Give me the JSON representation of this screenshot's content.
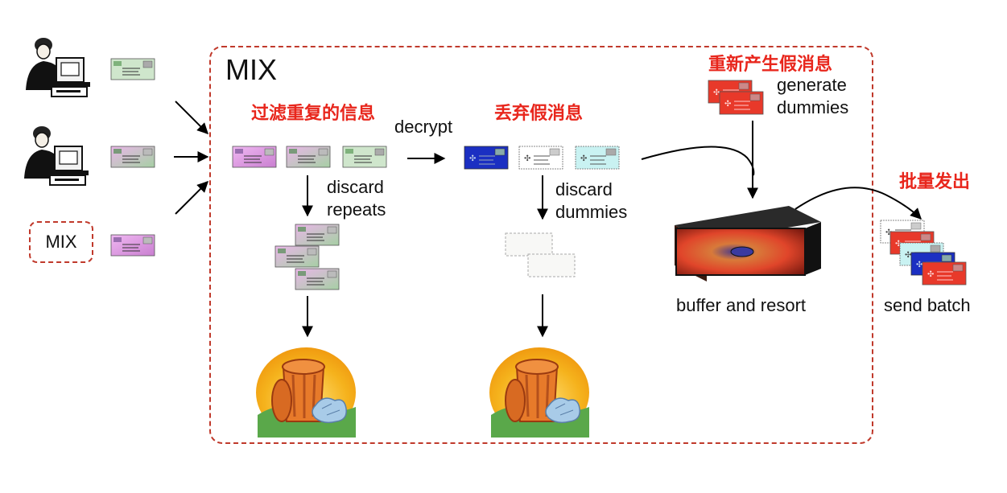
{
  "mix_box": {
    "title": "MIX"
  },
  "inputs": {
    "source_mix_label": "MIX"
  },
  "labels_cn": {
    "filter_repeats": "过滤重复的信息",
    "discard_dummies": "丢弃假消息",
    "regenerate_dummies": "重新产生假消息",
    "batch_send": "批量发出"
  },
  "labels_en": {
    "decrypt": "decrypt",
    "discard_repeats_1": "discard",
    "discard_repeats_2": "repeats",
    "discard_dummies_1": "discard",
    "discard_dummies_2": "dummies",
    "generate_dummies_1": "generate",
    "generate_dummies_2": "dummies",
    "buffer": "buffer and resort",
    "send_batch": "send batch"
  },
  "colors": {
    "accent_red": "#e8261c",
    "border_red": "#c0392b",
    "message_pink": "#e7a7e8",
    "message_green": "#b9d6b8",
    "message_blue": "#1b2fc2",
    "message_red": "#e8392a"
  },
  "icons": [
    "person-computer-icon",
    "envelope-icon",
    "trash-can-icon",
    "buffer-box-icon",
    "arrow-icon"
  ]
}
